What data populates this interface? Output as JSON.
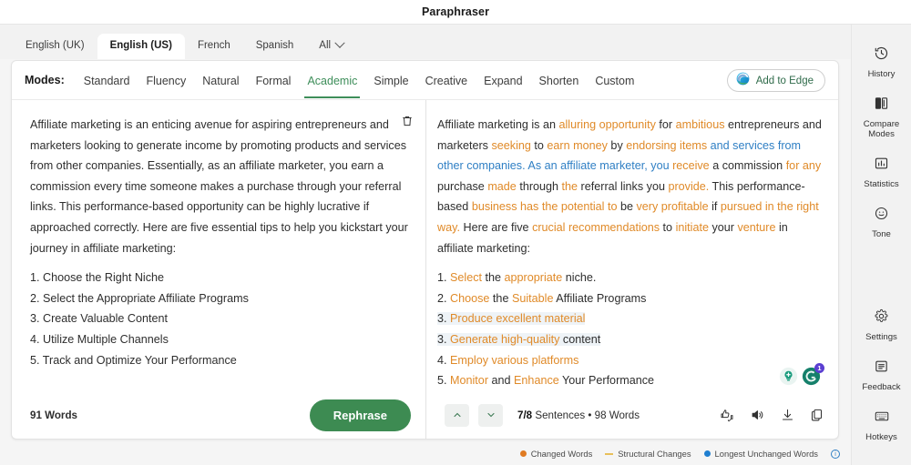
{
  "titlebar": {
    "title": "Paraphraser"
  },
  "languages": {
    "tabs": [
      {
        "label": "English (UK)",
        "active": false
      },
      {
        "label": "English (US)",
        "active": true
      },
      {
        "label": "French",
        "active": false
      },
      {
        "label": "Spanish",
        "active": false
      }
    ],
    "all_label": "All"
  },
  "modes": {
    "label": "Modes:",
    "items": [
      {
        "label": "Standard",
        "active": false
      },
      {
        "label": "Fluency",
        "active": false
      },
      {
        "label": "Natural",
        "active": false
      },
      {
        "label": "Formal",
        "active": false
      },
      {
        "label": "Academic",
        "active": true
      },
      {
        "label": "Simple",
        "active": false
      },
      {
        "label": "Creative",
        "active": false
      },
      {
        "label": "Expand",
        "active": false
      },
      {
        "label": "Shorten",
        "active": false
      },
      {
        "label": "Custom",
        "active": false
      }
    ],
    "add_to_edge": "Add to Edge"
  },
  "input_panel": {
    "paragraph": "Affiliate marketing is an enticing avenue for aspiring entrepreneurs and marketers looking to generate income by promoting products and services from other companies. Essentially, as an affiliate marketer, you earn a commission every time someone makes a purchase through your referral links. This performance-based opportunity can be highly lucrative if approached correctly. Here are five essential tips to help you kickstart your journey in affiliate marketing:",
    "list": [
      "1. Choose the Right Niche",
      "2. Select the Appropriate Affiliate Programs",
      "3. Create Valuable Content",
      "4. Utilize Multiple Channels",
      "5. Track and Optimize Your Performance"
    ],
    "word_count": "91 Words",
    "rephrase_label": "Rephrase",
    "delete_icon": "trash-icon"
  },
  "output_panel": {
    "paragraph_segments": [
      {
        "text": "Affiliate marketing is an ",
        "type": "plain"
      },
      {
        "text": "alluring opportunity",
        "type": "changed"
      },
      {
        "text": " for ",
        "type": "plain"
      },
      {
        "text": "ambitious",
        "type": "changed"
      },
      {
        "text": " entrepreneurs and marketers ",
        "type": "plain"
      },
      {
        "text": "seeking",
        "type": "changed"
      },
      {
        "text": " to ",
        "type": "plain"
      },
      {
        "text": "earn money",
        "type": "changed"
      },
      {
        "text": " by ",
        "type": "plain"
      },
      {
        "text": "endorsing items",
        "type": "changed"
      },
      {
        "text": " and services from other companies.",
        "type": "structural"
      },
      {
        "text": " ",
        "type": "plain"
      },
      {
        "text": "As an affiliate marketer, you",
        "type": "structural"
      },
      {
        "text": " ",
        "type": "plain"
      },
      {
        "text": "receive",
        "type": "changed"
      },
      {
        "text": " a commission ",
        "type": "plain"
      },
      {
        "text": "for any",
        "type": "changed"
      },
      {
        "text": " purchase ",
        "type": "plain"
      },
      {
        "text": "made",
        "type": "changed"
      },
      {
        "text": " through ",
        "type": "plain"
      },
      {
        "text": "the",
        "type": "changed"
      },
      {
        "text": " referral links you ",
        "type": "plain"
      },
      {
        "text": "provide.",
        "type": "changed"
      },
      {
        "text": " This performance-based ",
        "type": "plain"
      },
      {
        "text": "business has the potential to",
        "type": "changed"
      },
      {
        "text": " be ",
        "type": "plain"
      },
      {
        "text": "very profitable",
        "type": "changed"
      },
      {
        "text": " if ",
        "type": "plain"
      },
      {
        "text": "pursued in the right way.",
        "type": "changed"
      },
      {
        "text": " Here are five ",
        "type": "plain"
      },
      {
        "text": "crucial recommendations",
        "type": "changed"
      },
      {
        "text": " to ",
        "type": "plain"
      },
      {
        "text": "initiate",
        "type": "changed"
      },
      {
        "text": " your ",
        "type": "plain"
      },
      {
        "text": "venture",
        "type": "changed"
      },
      {
        "text": " in affiliate marketing:",
        "type": "plain"
      }
    ],
    "list": [
      {
        "highlighted": false,
        "segments": [
          {
            "text": "1. ",
            "type": "plain"
          },
          {
            "text": "Select",
            "type": "changed"
          },
          {
            "text": " the ",
            "type": "plain"
          },
          {
            "text": "appropriate",
            "type": "changed"
          },
          {
            "text": " niche.",
            "type": "plain"
          }
        ]
      },
      {
        "highlighted": false,
        "segments": [
          {
            "text": "2. ",
            "type": "plain"
          },
          {
            "text": "Choose",
            "type": "changed"
          },
          {
            "text": " the ",
            "type": "plain"
          },
          {
            "text": "Suitable",
            "type": "changed"
          },
          {
            "text": " Affiliate Programs",
            "type": "plain"
          }
        ]
      },
      {
        "highlighted": true,
        "segments": [
          {
            "text": "3. ",
            "type": "plain"
          },
          {
            "text": "Produce excellent material",
            "type": "changed"
          }
        ]
      },
      {
        "highlighted": true,
        "segments": [
          {
            "text": "3. ",
            "type": "plain"
          },
          {
            "text": "Generate high-quality",
            "type": "changed"
          },
          {
            "text": " content",
            "type": "plain"
          }
        ]
      },
      {
        "highlighted": false,
        "segments": [
          {
            "text": "4. ",
            "type": "plain"
          },
          {
            "text": "Employ various platforms",
            "type": "changed"
          }
        ]
      },
      {
        "highlighted": false,
        "segments": [
          {
            "text": "5. ",
            "type": "plain"
          },
          {
            "text": "Monitor",
            "type": "changed"
          },
          {
            "text": " and ",
            "type": "plain"
          },
          {
            "text": "Enhance",
            "type": "changed"
          },
          {
            "text": " Your Performance",
            "type": "plain"
          }
        ]
      }
    ],
    "sentence_count": "7/8",
    "sentence_label": " Sentences  •  98 Words",
    "prev_icon": "chevron-up-icon",
    "next_icon": "chevron-down-icon",
    "foot_icons": [
      "thumbs-feedback-icon",
      "speaker-icon",
      "download-icon",
      "copy-icon"
    ],
    "floaters": [
      {
        "name": "idea-bulb-icon",
        "badge": ""
      },
      {
        "name": "grammarly-icon",
        "badge": "1"
      }
    ]
  },
  "legend": {
    "items": [
      {
        "label": "Changed Words",
        "marker": "dot",
        "color": "#e07b22"
      },
      {
        "label": "Structural Changes",
        "marker": "dash",
        "color": "#e8c05a"
      },
      {
        "label": "Longest Unchanged Words",
        "marker": "dot",
        "color": "#1f7fd0"
      }
    ],
    "info_icon": "info-icon"
  },
  "rail": {
    "top_items": [
      {
        "label": "History",
        "icon": "history-icon"
      },
      {
        "label": "Compare\nModes",
        "icon": "compare-modes-icon"
      },
      {
        "label": "Statistics",
        "icon": "statistics-icon"
      },
      {
        "label": "Tone",
        "icon": "tone-icon"
      }
    ],
    "bottom_items": [
      {
        "label": "Settings",
        "icon": "gear-icon"
      },
      {
        "label": "Feedback",
        "icon": "feedback-icon"
      },
      {
        "label": "Hotkeys",
        "icon": "keyboard-icon"
      }
    ]
  },
  "colors": {
    "accent_green": "#3d8b52",
    "changed": "#e08a28",
    "structural": "#2f7fc4"
  }
}
